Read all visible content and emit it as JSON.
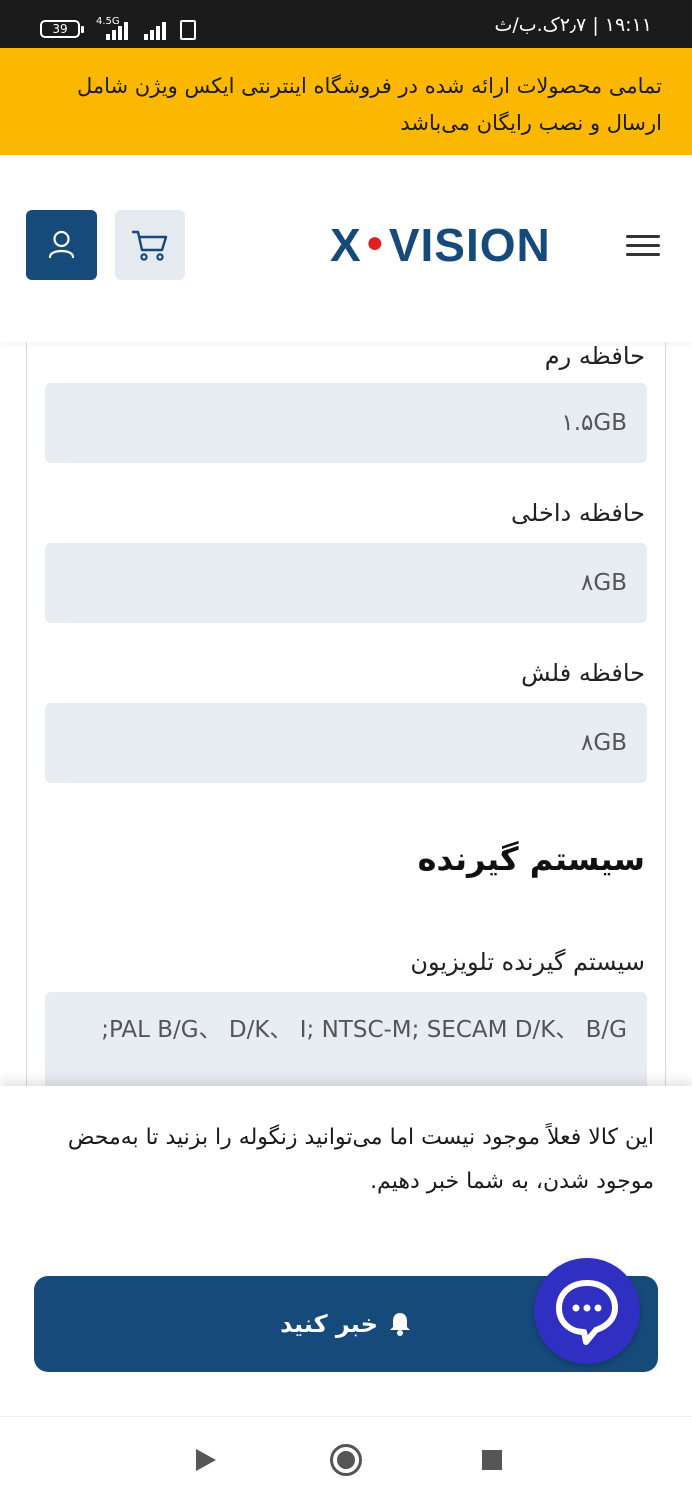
{
  "status_bar": {
    "time": "۱۹:۱۱ | ۲٫۷ک.ب/ث",
    "battery": "39",
    "network": "4.5G"
  },
  "promo": {
    "text": "تمامی محصولات ارائه شده در فروشگاه اینترنتی ایکس ویژن شامل ارسال و نصب رایگان می‌باشد"
  },
  "header": {
    "logo_left": "X",
    "logo_right": "VISION",
    "logo_dot": "●"
  },
  "specs": [
    {
      "label": "حافظه رم",
      "value": "۱.۵GB"
    },
    {
      "label": "حافظه داخلی",
      "value": "۸GB"
    },
    {
      "label": "حافظه فلش",
      "value": "۸GB"
    }
  ],
  "receiver_section": {
    "title": "سیستم گیرنده",
    "label": "سیستم گیرنده تلویزیون",
    "value": "PAL B/G、 D/K、 I;  NTSC-M;  SECAM D/K、 B/G;"
  },
  "sheet": {
    "notice": "این کالا فعلاً موجود نیست اما می‌توانید زنگوله را بزنید تا به‌محض موجود شدن، به شما خبر دهیم.",
    "button_label": "خبر کنید"
  },
  "colors": {
    "accent": "#154a7a",
    "promo": "#fcb700",
    "chat": "#2f2fc2"
  }
}
